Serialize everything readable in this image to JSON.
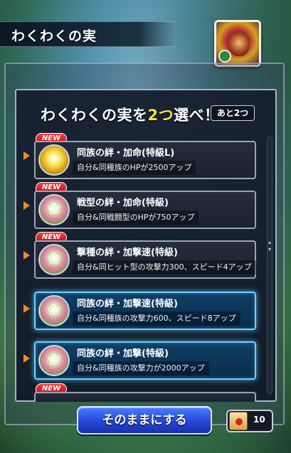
{
  "header": {
    "title": "わくわくの実"
  },
  "heading": {
    "prefix": "わくわくの実を",
    "highlight": "2つ",
    "suffix": "選べ！"
  },
  "counter": {
    "label": "あと2つ"
  },
  "new_label": "NEW",
  "items": [
    {
      "name": "同族の絆・加命(特級L)",
      "desc": "自分&同種族のHPが2500アップ",
      "icon": "golden-fruit-icon",
      "is_new": true,
      "selected": false
    },
    {
      "name": "戦型の絆・加命(特級)",
      "desc": "自分&同戦闘型のHPが750アップ",
      "icon": "lotus-fruit-icon",
      "is_new": true,
      "selected": false
    },
    {
      "name": "撃種の絆・加撃速(特級)",
      "desc": "自分&同ヒット型の攻撃力300、スピード4アップ",
      "icon": "lotus-fruit-icon",
      "is_new": true,
      "selected": false
    },
    {
      "name": "同族の絆・加撃速(特級)",
      "desc": "自分&同種族の攻撃力600、スピード8アップ",
      "icon": "lotus-fruit-icon",
      "is_new": false,
      "selected": true
    },
    {
      "name": "同族の絆・加撃(特級)",
      "desc": "自分&同種族の攻撃力が2000アップ",
      "icon": "lotus-fruit-icon",
      "is_new": false,
      "selected": true
    }
  ],
  "footer": {
    "keep_button": "そのままにする",
    "scroll_count": "10"
  },
  "colors": {
    "highlight": "#ffe23a",
    "new_badge": "#d61a22",
    "selected_border": "#6fd0ff",
    "button": "#2348d8"
  }
}
